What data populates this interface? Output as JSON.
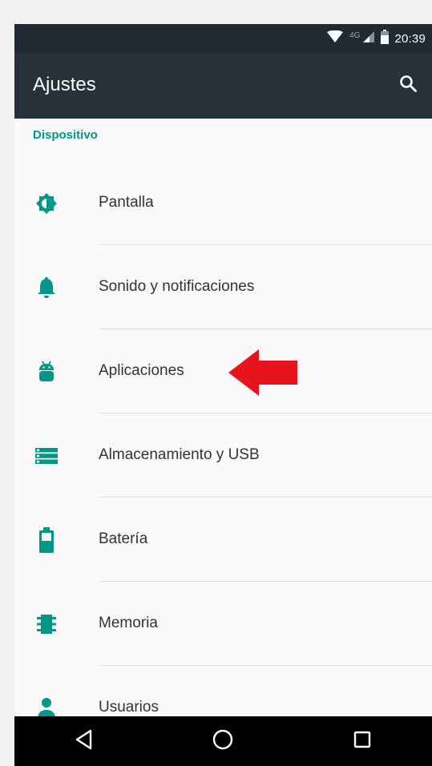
{
  "status_bar": {
    "network_label": "4G",
    "time": "20:39"
  },
  "app_bar": {
    "title": "Ajustes",
    "search_icon": "search-icon"
  },
  "section": {
    "header": "Dispositivo"
  },
  "items": [
    {
      "label": "Pantalla",
      "icon": "display-icon"
    },
    {
      "label": "Sonido y notificaciones",
      "icon": "bell-icon"
    },
    {
      "label": "Aplicaciones",
      "icon": "android-icon"
    },
    {
      "label": "Almacenamiento y USB",
      "icon": "storage-icon"
    },
    {
      "label": "Batería",
      "icon": "battery-icon"
    },
    {
      "label": "Memoria",
      "icon": "memory-icon"
    },
    {
      "label": "Usuarios",
      "icon": "user-icon"
    }
  ],
  "annotation": {
    "arrow_color": "#e8141c"
  },
  "colors": {
    "accent": "#009688",
    "app_bar": "#263238",
    "status_bar": "#1f2b30",
    "nav_bar": "#000000"
  },
  "nav": {
    "back_icon": "back-triangle-icon",
    "home_icon": "home-circle-icon",
    "recents_icon": "recents-square-icon"
  }
}
